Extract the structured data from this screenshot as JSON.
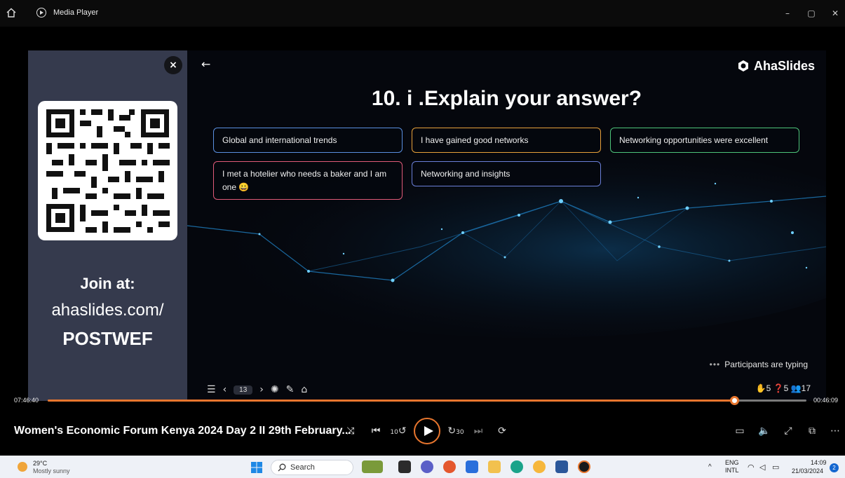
{
  "window": {
    "title": "Media Player",
    "minimize": "–",
    "restore": "▢",
    "close": "✕"
  },
  "slide": {
    "join_at": "Join at:",
    "join_url": "ahaslides.com/",
    "join_code": "POSTWEF",
    "close_label": "×",
    "back_label": "←",
    "brand": "AhaSlides",
    "question": "10. i .Explain your answer?",
    "responses": [
      {
        "text": "Global and international trends",
        "color": "#5a8fe0"
      },
      {
        "text": "I have gained good networks",
        "color": "#e8a13a"
      },
      {
        "text": "Networking opportunities were excellent",
        "color": "#4dc47a"
      },
      {
        "text": "I met a hotelier who needs a baker and I am one 😀",
        "color": "#e05a78"
      },
      {
        "text": "Networking and insights",
        "color": "#6a7fd8"
      }
    ],
    "typing_dots": "•••",
    "typing_status": "Participants are typing",
    "page_number": "13",
    "stats": {
      "reactions": "5",
      "questions": "5",
      "participants": "17"
    }
  },
  "player": {
    "elapsed": "07:46:40",
    "remaining": "00:46:09",
    "progress": 0.905,
    "video_title": "Women's Economic Forum Kenya 2024 Day 2 II  29th February...",
    "accent": "#e8762e",
    "rewind_label": "10",
    "forward_label": "30"
  },
  "taskbar": {
    "weather_temp": "29°C",
    "weather_desc": "Mostly sunny",
    "search_label": "Search",
    "lang_top": "ENG",
    "lang_bottom": "INTL",
    "time": "14:09",
    "date": "21/03/2024",
    "notifications": "2"
  }
}
